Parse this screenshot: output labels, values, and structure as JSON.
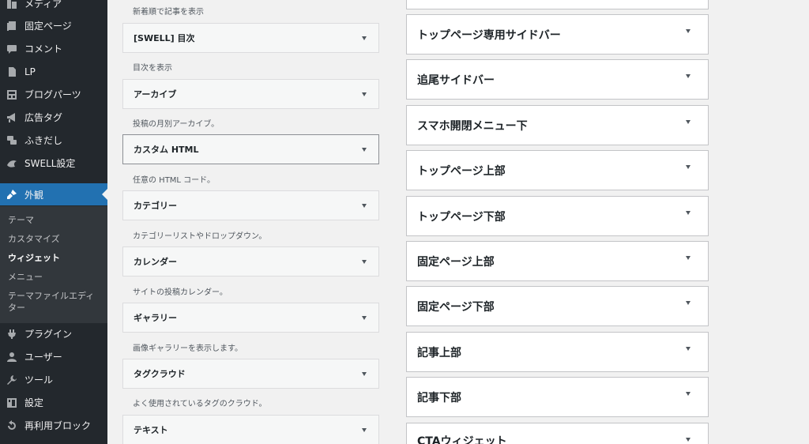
{
  "admin_menu": {
    "items_top": [
      {
        "label": "メディア",
        "icon": "media-icon"
      },
      {
        "label": "固定ページ",
        "icon": "page-icon"
      },
      {
        "label": "コメント",
        "icon": "comment-icon"
      },
      {
        "label": "LP",
        "icon": "document-icon"
      },
      {
        "label": "ブログパーツ",
        "icon": "layout-icon"
      },
      {
        "label": "広告タグ",
        "icon": "megaphone-icon"
      },
      {
        "label": "ふきだし",
        "icon": "speech-bubble-icon"
      },
      {
        "label": "SWELL設定",
        "icon": "swell-icon"
      }
    ],
    "active": {
      "label": "外観",
      "icon": "brush-icon"
    },
    "submenu": [
      "テーマ",
      "カスタマイズ",
      "ウィジェット",
      "メニュー",
      "テーマファイルエディター"
    ],
    "submenu_current": "ウィジェット",
    "items_bottom": [
      {
        "label": "プラグイン",
        "icon": "plugin-icon"
      },
      {
        "label": "ユーザー",
        "icon": "user-icon"
      },
      {
        "label": "ツール",
        "icon": "wrench-icon"
      },
      {
        "label": "設定",
        "icon": "settings-icon"
      },
      {
        "label": "再利用ブロック",
        "icon": "undo-icon"
      }
    ]
  },
  "available_widgets": {
    "top_description": "新着順で記事を表示",
    "widgets": [
      {
        "title": "[SWELL] 目次",
        "description": "目次を表示"
      },
      {
        "title": "アーカイブ",
        "description": "投稿の月別アーカイブ。"
      },
      {
        "title": "カスタム HTML",
        "description": "任意の HTML コード。"
      },
      {
        "title": "カテゴリー",
        "description": "カテゴリーリストやドロップダウン。"
      },
      {
        "title": "カレンダー",
        "description": "サイトの投稿カレンダー。"
      },
      {
        "title": "ギャラリー",
        "description": "画像ギャラリーを表示します。"
      },
      {
        "title": "タグクラウド",
        "description": "よく使用されているタグのクラウド。"
      },
      {
        "title": "テキスト",
        "description": ""
      }
    ]
  },
  "widget_areas": [
    "トップページ専用サイドバー",
    "追尾サイドバー",
    "スマホ開閉メニュー下",
    "トップページ上部",
    "トップページ下部",
    "固定ページ上部",
    "固定ページ下部",
    "記事上部",
    "記事下部",
    "CTAウィジェット"
  ],
  "colors": {
    "sidebar_bg": "#23282d",
    "active_bg": "#2271b1",
    "page_bg": "#f1f1f1"
  }
}
